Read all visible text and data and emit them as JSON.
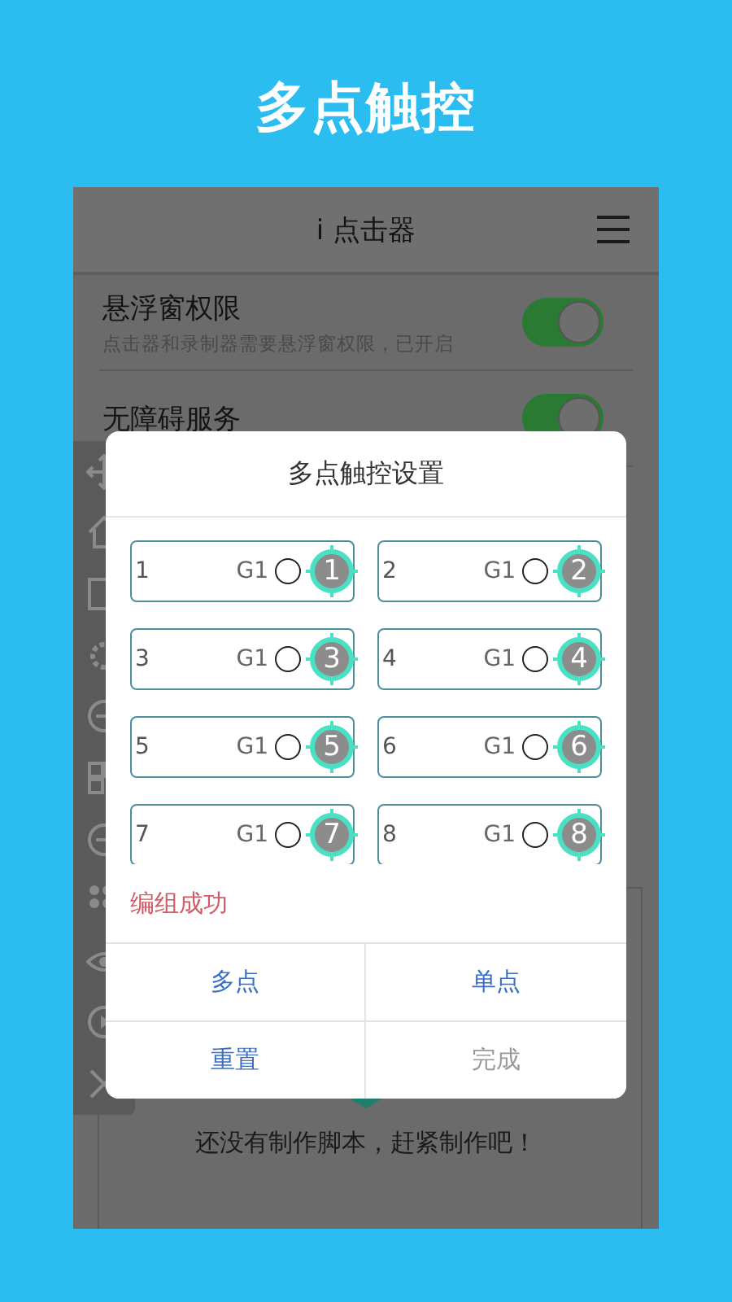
{
  "headline": "多点触控",
  "app": {
    "title": "i 点击器",
    "settings": [
      {
        "title": "悬浮窗权限",
        "subtitle": "点击器和录制器需要悬浮窗权限，已开启",
        "on": true
      },
      {
        "title": "无障碍服务",
        "on": true
      }
    ],
    "empty_message": "还没有制作脚本，赶紧制作吧！"
  },
  "dialog": {
    "title": "多点触控设置",
    "slots": [
      {
        "number": "1",
        "group": "G1",
        "selected": false,
        "marker": "1"
      },
      {
        "number": "2",
        "group": "G1",
        "selected": false,
        "marker": "2"
      },
      {
        "number": "3",
        "group": "G1",
        "selected": false,
        "marker": "3"
      },
      {
        "number": "4",
        "group": "G1",
        "selected": false,
        "marker": "4"
      },
      {
        "number": "5",
        "group": "G1",
        "selected": false,
        "marker": "5"
      },
      {
        "number": "6",
        "group": "G1",
        "selected": false,
        "marker": "6"
      },
      {
        "number": "7",
        "group": "G1",
        "selected": false,
        "marker": "7"
      },
      {
        "number": "8",
        "group": "G1",
        "selected": false,
        "marker": "8"
      }
    ],
    "status": "编组成功",
    "buttons": [
      {
        "label": "多点",
        "disabled": false
      },
      {
        "label": "单点",
        "disabled": false
      },
      {
        "label": "重置",
        "disabled": false
      },
      {
        "label": "完成",
        "disabled": true
      }
    ]
  }
}
